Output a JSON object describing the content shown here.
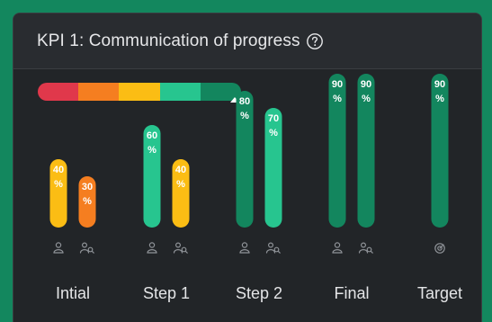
{
  "card": {
    "title": "KPI 1: Communication of progress",
    "help_icon": "question-circle-icon"
  },
  "scale": {
    "colors": [
      "#e0384b",
      "#f57e20",
      "#fbbd14",
      "#27c58f",
      "#13865e"
    ],
    "marker_position": 0.96
  },
  "chart_data": {
    "type": "bar",
    "categories": [
      "Intial",
      "Step 1",
      "Step 2",
      "Final",
      "Target"
    ],
    "ylim": [
      0,
      100
    ],
    "groups": [
      {
        "label": "Intial",
        "bars": [
          {
            "value": 40,
            "label": "40 %",
            "color": "#fbbd14",
            "icon": "person-icon"
          },
          {
            "value": 30,
            "label": "30 %",
            "color": "#f57e20",
            "icon": "people-search-icon"
          }
        ]
      },
      {
        "label": "Step 1",
        "bars": [
          {
            "value": 60,
            "label": "60 %",
            "color": "#27c58f",
            "icon": "person-icon"
          },
          {
            "value": 40,
            "label": "40 %",
            "color": "#fbbd14",
            "icon": "people-search-icon"
          }
        ]
      },
      {
        "label": "Step 2",
        "bars": [
          {
            "value": 80,
            "label": "80 %",
            "color": "#13865e",
            "icon": "person-icon"
          },
          {
            "value": 70,
            "label": "70 %",
            "color": "#27c58f",
            "icon": "people-search-icon"
          }
        ]
      },
      {
        "label": "Final",
        "bars": [
          {
            "value": 90,
            "label": "90 %",
            "color": "#13865e",
            "icon": "person-icon"
          },
          {
            "value": 90,
            "label": "90 %",
            "color": "#13865e",
            "icon": "people-search-icon"
          }
        ]
      },
      {
        "label": "Target",
        "bars": [
          {
            "value": 90,
            "label": "90 %",
            "color": "#13865e",
            "icon": "target-icon"
          }
        ]
      }
    ]
  }
}
